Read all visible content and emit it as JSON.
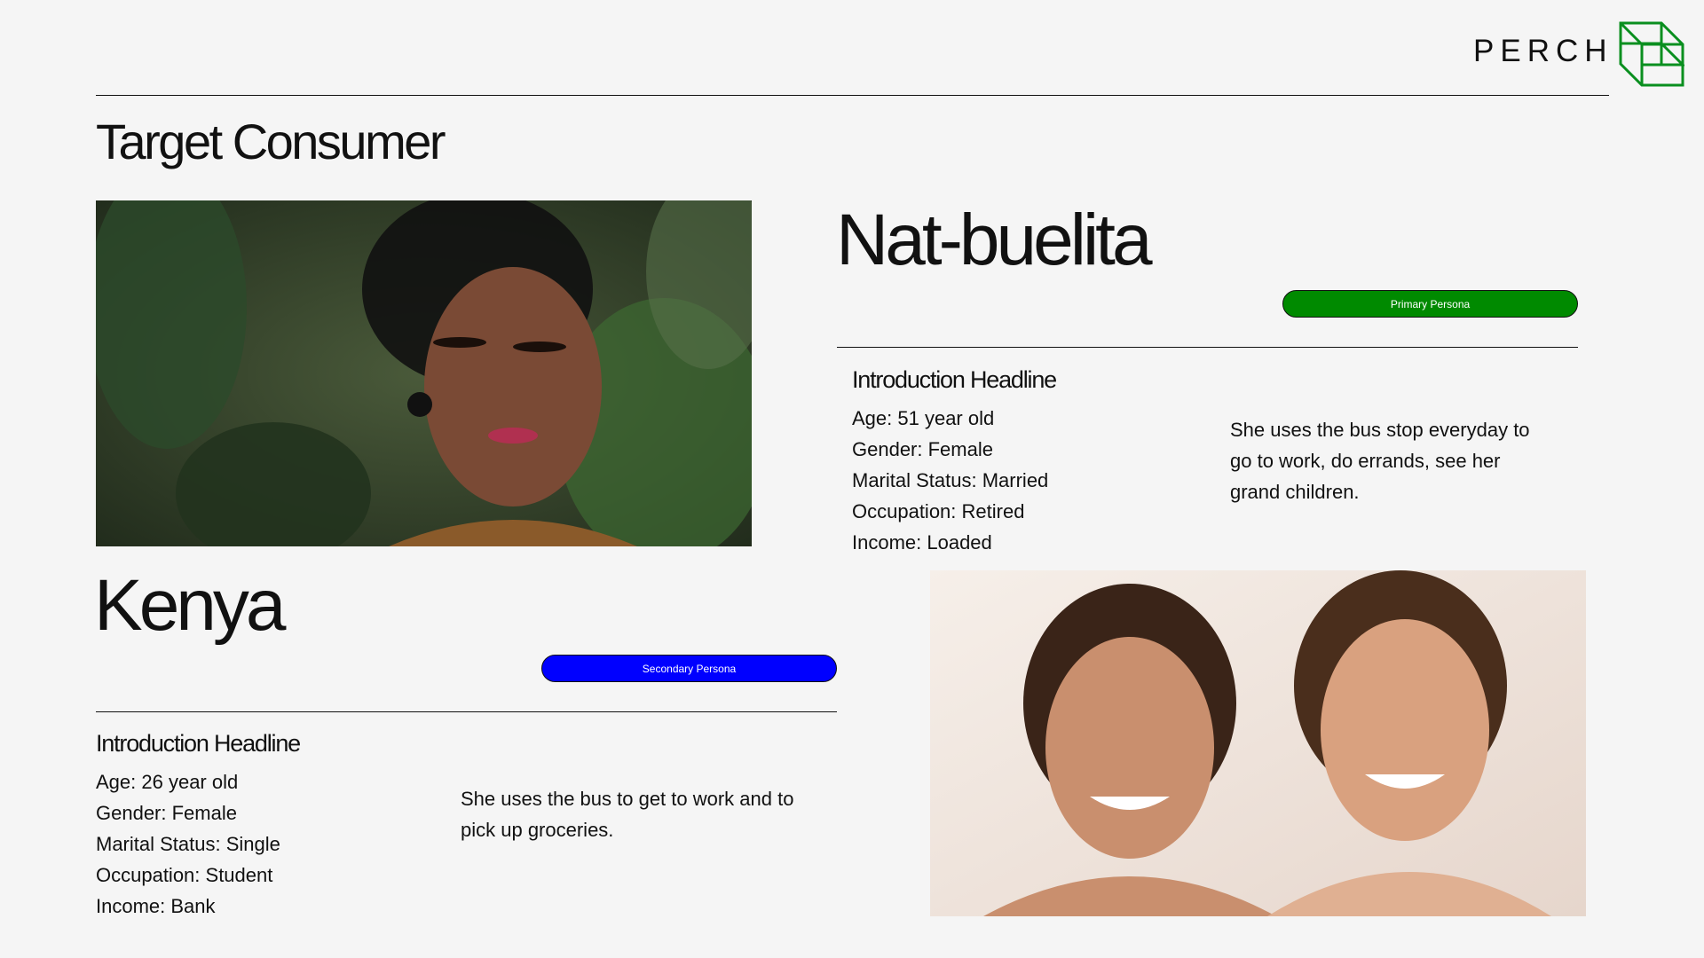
{
  "header": {
    "brand": "PERCH",
    "logo_icon": "cube-outline-icon",
    "logo_color": "#0a8f1f"
  },
  "page_title": "Target Consumer",
  "personas": {
    "nat": {
      "name": "Nat-buelita",
      "badge": "Primary Persona",
      "badge_color": "#008a00",
      "headline": "Introduction Headline",
      "facts": [
        "Age: 51 year old",
        "Gender: Female",
        "Marital Status: Married",
        "Occupation: Retired",
        "Income: Loaded"
      ],
      "description": "She uses the bus stop everyday to go to work, do errands, see her grand children."
    },
    "kenya": {
      "name": "Kenya",
      "badge": "Secondary Persona",
      "badge_color": "#0000ff",
      "headline": "Introduction Headline",
      "facts": [
        "Age: 26 year old",
        "Gender: Female",
        "Marital Status: Single",
        "Occupation: Student",
        "Income: Bank"
      ],
      "description": "She uses the bus to get to work and to pick up groceries."
    }
  }
}
